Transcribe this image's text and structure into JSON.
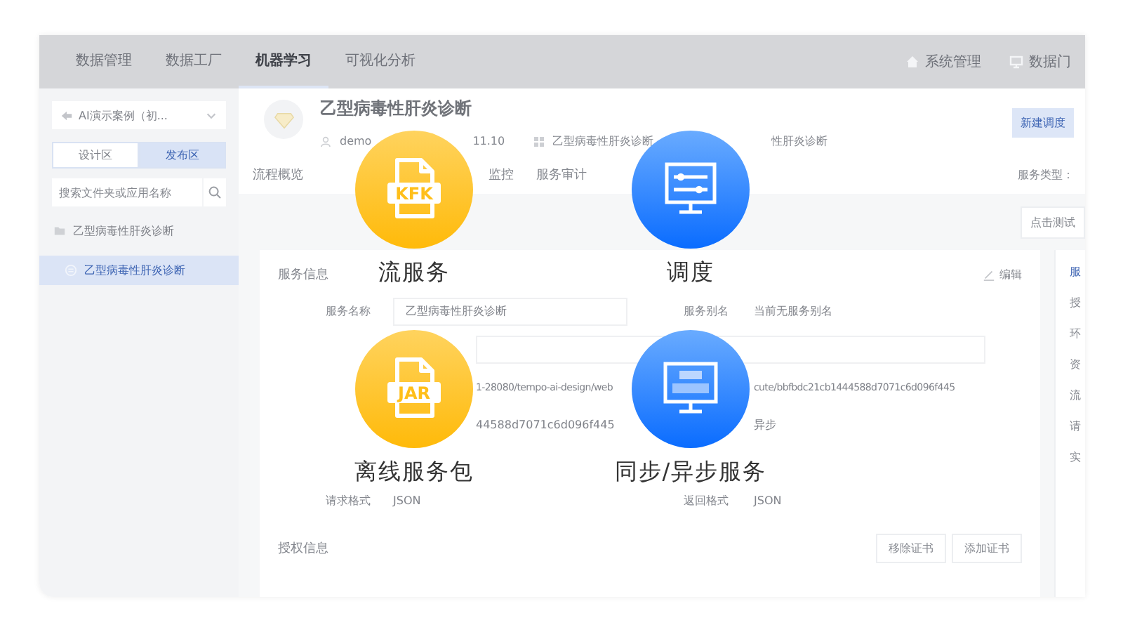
{
  "nav": {
    "items": [
      {
        "label": "数据管理",
        "selected": false
      },
      {
        "label": "数据工厂",
        "selected": false
      },
      {
        "label": "机器学习",
        "selected": true
      },
      {
        "label": "可视化分析",
        "selected": false
      }
    ],
    "links": [
      {
        "kind": "home",
        "label": "系统管理"
      },
      {
        "kind": "portal",
        "label": "数据门"
      }
    ]
  },
  "sidebar": {
    "project": "AI演示案例（初...",
    "tabs": [
      {
        "label": "设计区",
        "selected": false
      },
      {
        "label": "发布区",
        "selected": true
      }
    ],
    "search": {
      "placeholder": "搜索文件夹或应用名称"
    },
    "tree": [
      {
        "label": "乙型病毒性肝炎诊断",
        "selected": false,
        "children": [
          {
            "label": "乙型病毒性肝炎诊断",
            "selected": true
          }
        ]
      }
    ]
  },
  "header": {
    "title": "乙型病毒性肝炎诊断",
    "user": "demo",
    "date": "11.10",
    "app": "乙型病毒性肝炎诊断",
    "path": "性肝炎诊断",
    "new_button": "新建调度",
    "tabs": [
      {
        "label": "流程概览",
        "selected": false
      },
      {
        "label": "监控",
        "selected": false
      },
      {
        "label": "服务审计",
        "selected": false
      }
    ],
    "service_type": "服务类型："
  },
  "test_button": "点击测试",
  "service_info": {
    "title": "服务信息",
    "edit": "编辑",
    "name_label": "服务名称",
    "name_value": "乙型病毒性肝炎诊断",
    "alias_label": "服务别名",
    "alias_value": "当前无服务别名",
    "address_left": "1-28080/tempo-ai-design/web",
    "address_right": "cute/bbfbdc21cb1444588d7071c6d096f445",
    "id_value": "44588d7071c6d096f445",
    "mode_value": "异步",
    "request_format_label": "请求格式",
    "request_format_value": "JSON",
    "response_format_label": "返回格式",
    "response_format_value": "JSON"
  },
  "auth": {
    "title": "授权信息",
    "buttons": [
      "移除证书",
      "添加证书"
    ]
  },
  "side_nav": [
    {
      "label": "服",
      "selected": true
    },
    {
      "label": "授",
      "selected": false
    },
    {
      "label": "环",
      "selected": false
    },
    {
      "label": "资",
      "selected": false
    },
    {
      "label": "流",
      "selected": false
    },
    {
      "label": "请",
      "selected": false
    },
    {
      "label": "实",
      "selected": false
    }
  ],
  "features": [
    {
      "kind": "kfk",
      "badge": "KFK",
      "label": "流服务"
    },
    {
      "kind": "schedule",
      "label": "调度"
    },
    {
      "kind": "jar",
      "badge": "JAR",
      "label": "离线服务包"
    },
    {
      "kind": "api",
      "label": "同步/异步服务"
    }
  ]
}
